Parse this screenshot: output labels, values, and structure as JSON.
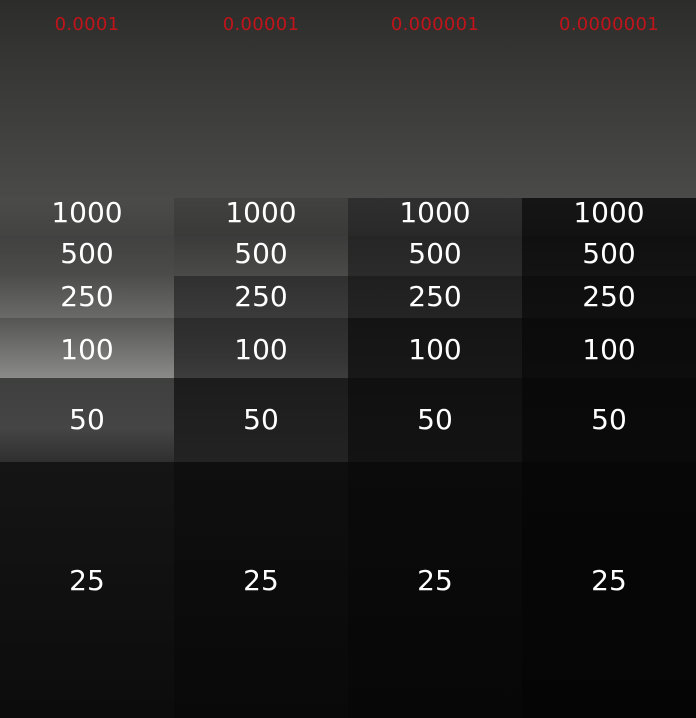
{
  "columns": [
    {
      "label": "0.0001",
      "levels": [
        "1000",
        "500",
        "250",
        "100",
        "50",
        "25"
      ]
    },
    {
      "label": "0.00001",
      "levels": [
        "1000",
        "500",
        "250",
        "100",
        "50",
        "25"
      ]
    },
    {
      "label": "0.000001",
      "levels": [
        "1000",
        "500",
        "250",
        "100",
        "50",
        "25"
      ]
    },
    {
      "label": "0.0000001",
      "levels": [
        "1000",
        "500",
        "250",
        "100",
        "50",
        "25"
      ]
    }
  ],
  "colors": {
    "column_label": "#c0141a",
    "level_label": "#ffffff",
    "background": "#080808"
  }
}
